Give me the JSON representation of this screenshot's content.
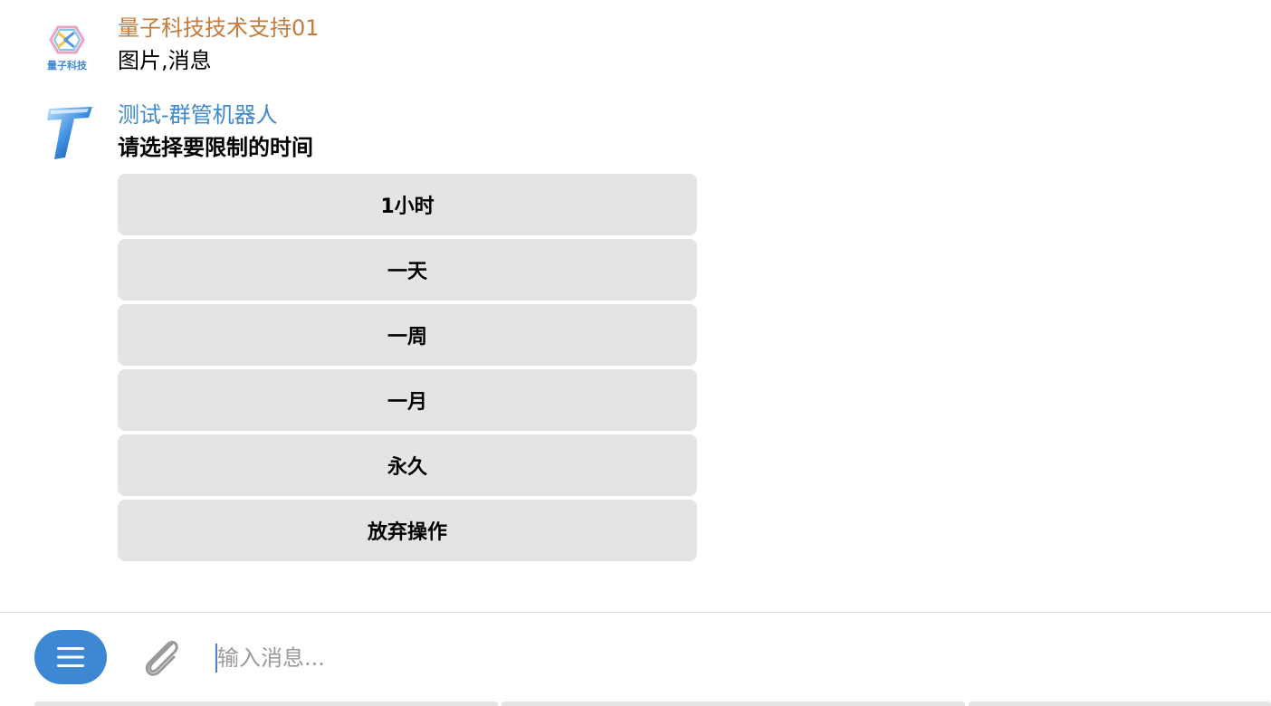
{
  "messages": [
    {
      "sender": "量子科技技术支持01",
      "avatar_label": "量子科技",
      "text": "图片,消息",
      "avatar_icon": "quantum-tech-logo"
    },
    {
      "sender": "测试-群管机器人",
      "text": "请选择要限制的时间",
      "avatar_icon": "t-bot-logo",
      "keyboard": [
        "1小时",
        "一天",
        "一周",
        "一月",
        "永久",
        "放弃操作"
      ]
    }
  ],
  "composer": {
    "placeholder": "输入消息...",
    "menu_icon": "menu-icon",
    "attach_icon": "paperclip-icon"
  },
  "colors": {
    "sender1": "#c57b3a",
    "sender2": "#3e88cc",
    "accent": "#3e88d3",
    "button_bg": "#e4e4e4"
  }
}
